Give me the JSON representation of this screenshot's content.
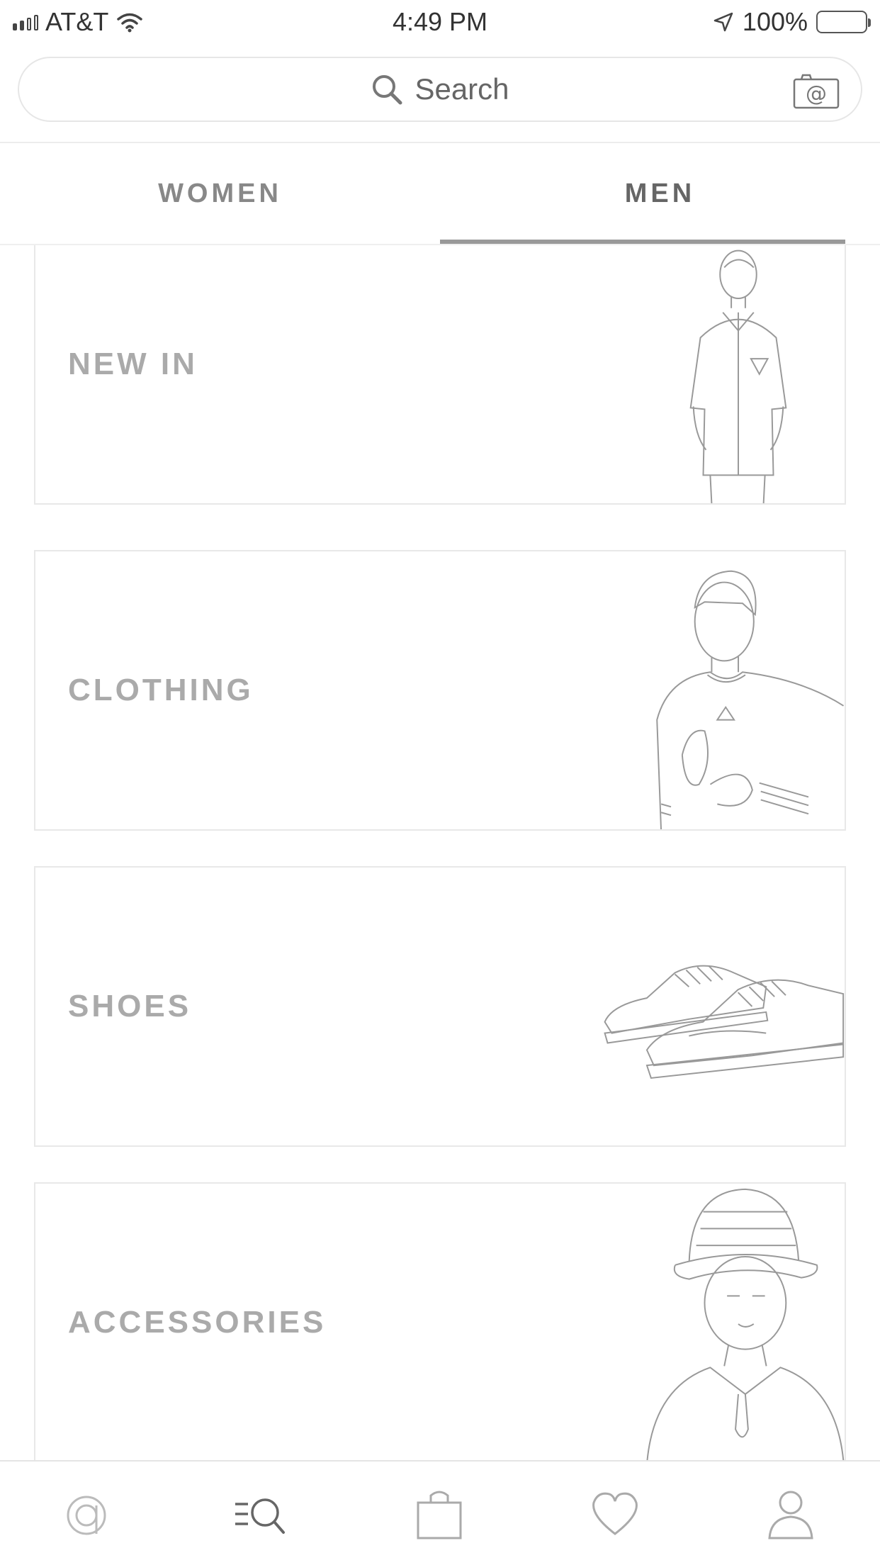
{
  "status_bar": {
    "carrier": "AT&T",
    "time": "4:49 PM",
    "battery": "100%"
  },
  "search": {
    "placeholder": "Search"
  },
  "tabs": [
    {
      "label": "WOMEN",
      "selected": false
    },
    {
      "label": "MEN",
      "selected": true
    }
  ],
  "categories": [
    {
      "label": "NEW IN",
      "image": "man-in-short-sleeve-shirt"
    },
    {
      "label": "CLOTHING",
      "image": "man-in-adidas-tshirt"
    },
    {
      "label": "SHOES",
      "image": "pair-of-sneakers"
    },
    {
      "label": "ACCESSORIES",
      "image": "man-in-bucket-hat"
    }
  ],
  "bottom_nav": [
    {
      "name": "home",
      "icon": "asos-logo-icon"
    },
    {
      "name": "search",
      "icon": "search-menu-icon",
      "active": true
    },
    {
      "name": "bag",
      "icon": "shopping-bag-icon"
    },
    {
      "name": "saved",
      "icon": "heart-icon"
    },
    {
      "name": "account",
      "icon": "user-icon"
    }
  ]
}
